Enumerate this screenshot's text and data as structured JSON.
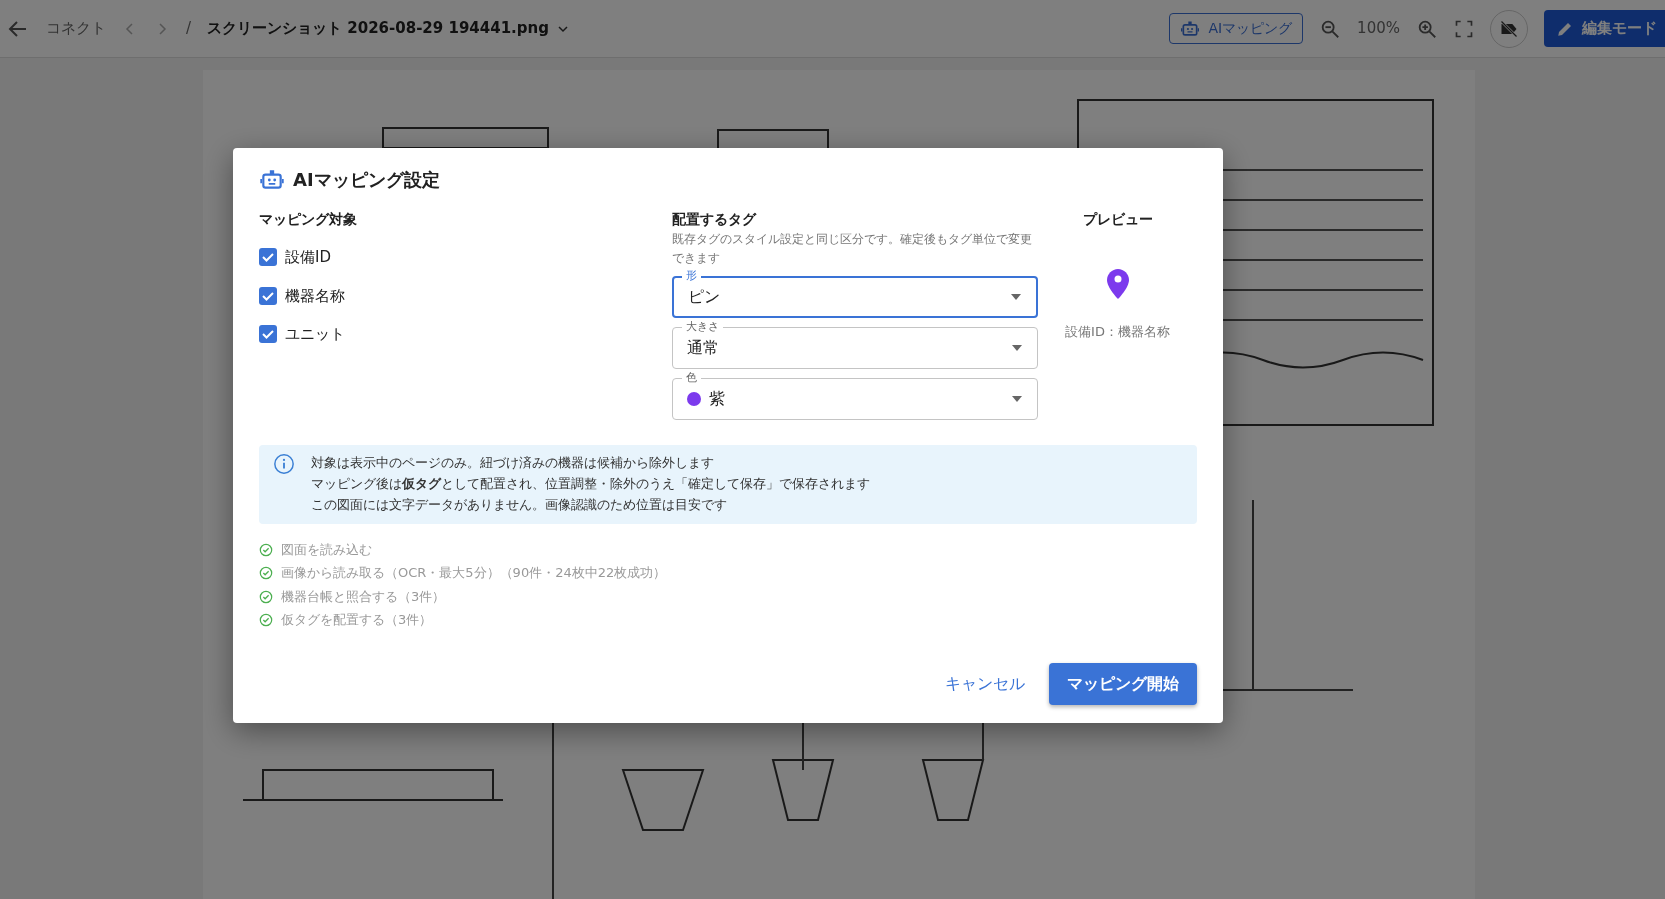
{
  "toolbar": {
    "breadcrumb": "コネクト",
    "separator": "/",
    "file_name": "スクリーンショット 2026-08-29 194441.png",
    "ai_button": "AIマッピング",
    "zoom": "100%",
    "edit_button": "編集モード"
  },
  "dialog": {
    "title": "AIマッピング設定",
    "targets": {
      "heading": "マッピング対象",
      "items": [
        {
          "label": "設備ID",
          "checked": true
        },
        {
          "label": "機器名称",
          "checked": true
        },
        {
          "label": "ユニット",
          "checked": true
        }
      ]
    },
    "tags": {
      "heading": "配置するタグ",
      "hint": "既存タグのスタイル設定と同じ区分です。確定後もタグ単位で変更できます",
      "fields": [
        {
          "label": "形",
          "value": "ピン",
          "focused": true
        },
        {
          "label": "大きさ",
          "value": "通常",
          "focused": false
        },
        {
          "label": "色",
          "value": "紫",
          "focused": false,
          "color": "#7c3aed"
        }
      ]
    },
    "preview": {
      "heading": "プレビュー",
      "caption": "設備ID：機器名称",
      "color": "#7c3aed"
    },
    "info": [
      "対象は表示中のページのみ。紐づけ済みの機器は候補から除外します",
      "マッピング後は**仮タグ**として配置され、位置調整・除外のうえ「確定して保存」で保存されます",
      "この図面には文字データがありません。画像認識のため位置は目安です"
    ],
    "steps": [
      {
        "label": "図面を読み込む",
        "done": true
      },
      {
        "label": "画像から読み取る（OCR・最大5分）（90件・24枚中22枚成功）",
        "done": true
      },
      {
        "label": "機器台帳と照合する（3件）",
        "done": true
      },
      {
        "label": "仮タグを配置する（3件）",
        "done": true
      }
    ],
    "buttons": {
      "cancel": "キャンセル",
      "start": "マッピング開始"
    }
  }
}
